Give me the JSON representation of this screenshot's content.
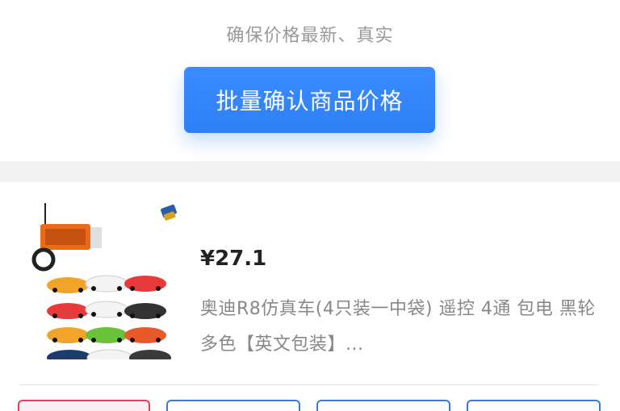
{
  "header": {
    "subtitle": "确保价格最新、真实",
    "confirm_button_label": "批量确认商品价格"
  },
  "product": {
    "price": "¥27.1",
    "name": "奥迪R8仿真车(4只装一中袋) 遥控 4通 包电 黑轮 多色【英文包装】..."
  },
  "colors": {
    "accent": "#2f7ff5",
    "price_text": "#222222",
    "muted_text": "#9a9a9a",
    "selected_border": "#e04060",
    "option_border": "#3a7bd5"
  }
}
